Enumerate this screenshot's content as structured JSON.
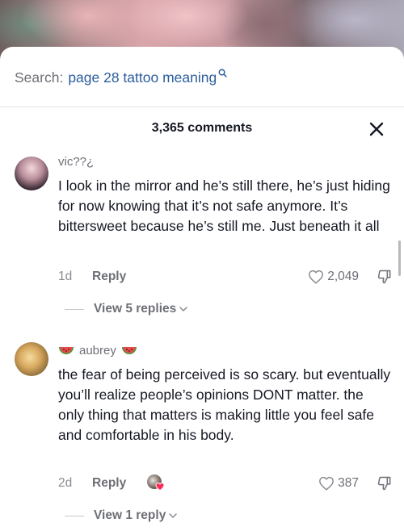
{
  "search": {
    "prefix": "Search:",
    "query": "page 28 tattoo meaning"
  },
  "header": {
    "title": "3,365 comments"
  },
  "comments": [
    {
      "username": "vic??¿",
      "text": "I look in the mirror and he’s still there, he’s just hiding for now knowing that it’s not safe anymore. It’s bittersweet because he’s still me. Just beneath it all",
      "time": "1d",
      "reply_label": "Reply",
      "likes": "2,049",
      "view_replies": "View 5 replies"
    },
    {
      "username": "aubrey",
      "username_emoji": "watermelon-icon",
      "text": "the fear of being perceived is so scary. but eventually you’ll realize people’s opinions DONT matter. the only thing that matters is making little you feel safe and comfortable in his body.",
      "time": "2d",
      "reply_label": "Reply",
      "likes": "387",
      "creator_liked": true,
      "view_replies": "View 1 reply"
    }
  ],
  "colors": {
    "link": "#2b5d9c",
    "muted": "#6e6f76",
    "text": "#161823",
    "heart_badge": "#fe2c55"
  }
}
